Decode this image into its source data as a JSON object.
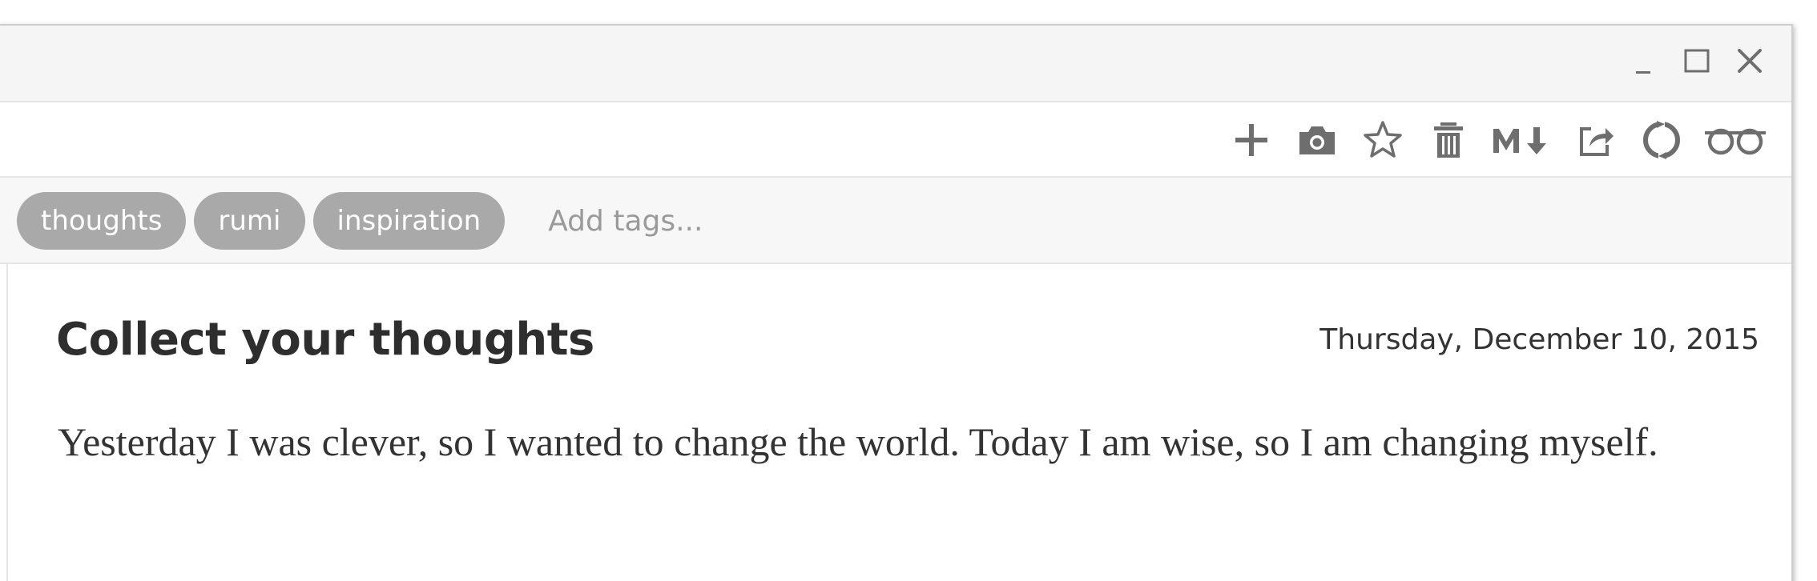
{
  "window": {
    "controls": {
      "minimize_icon": "minimize-icon",
      "maximize_icon": "maximize-icon",
      "close_icon": "close-icon"
    }
  },
  "toolbar": {
    "icons": [
      "plus-icon",
      "camera-icon",
      "star-icon",
      "trash-icon",
      "markdown-icon",
      "share-icon",
      "sync-icon",
      "reading-glasses-icon"
    ],
    "markdown_label": "M↓"
  },
  "tags": {
    "items": [
      {
        "label": "thoughts"
      },
      {
        "label": "rumi"
      },
      {
        "label": "inspiration"
      }
    ],
    "input_placeholder": "Add tags..."
  },
  "note": {
    "title": "Collect your thoughts",
    "date": "Thursday, December 10, 2015",
    "body": "Yesterday I was clever, so I wanted to change the world. Today I am wise, so I am changing myself."
  },
  "colors": {
    "icon": "#6e6e6e",
    "tag_bg": "#a9a9a9",
    "tag_text": "#ffffff",
    "titlebar_bg": "#f5f5f5",
    "tagbar_bg": "#f7f7f7"
  }
}
